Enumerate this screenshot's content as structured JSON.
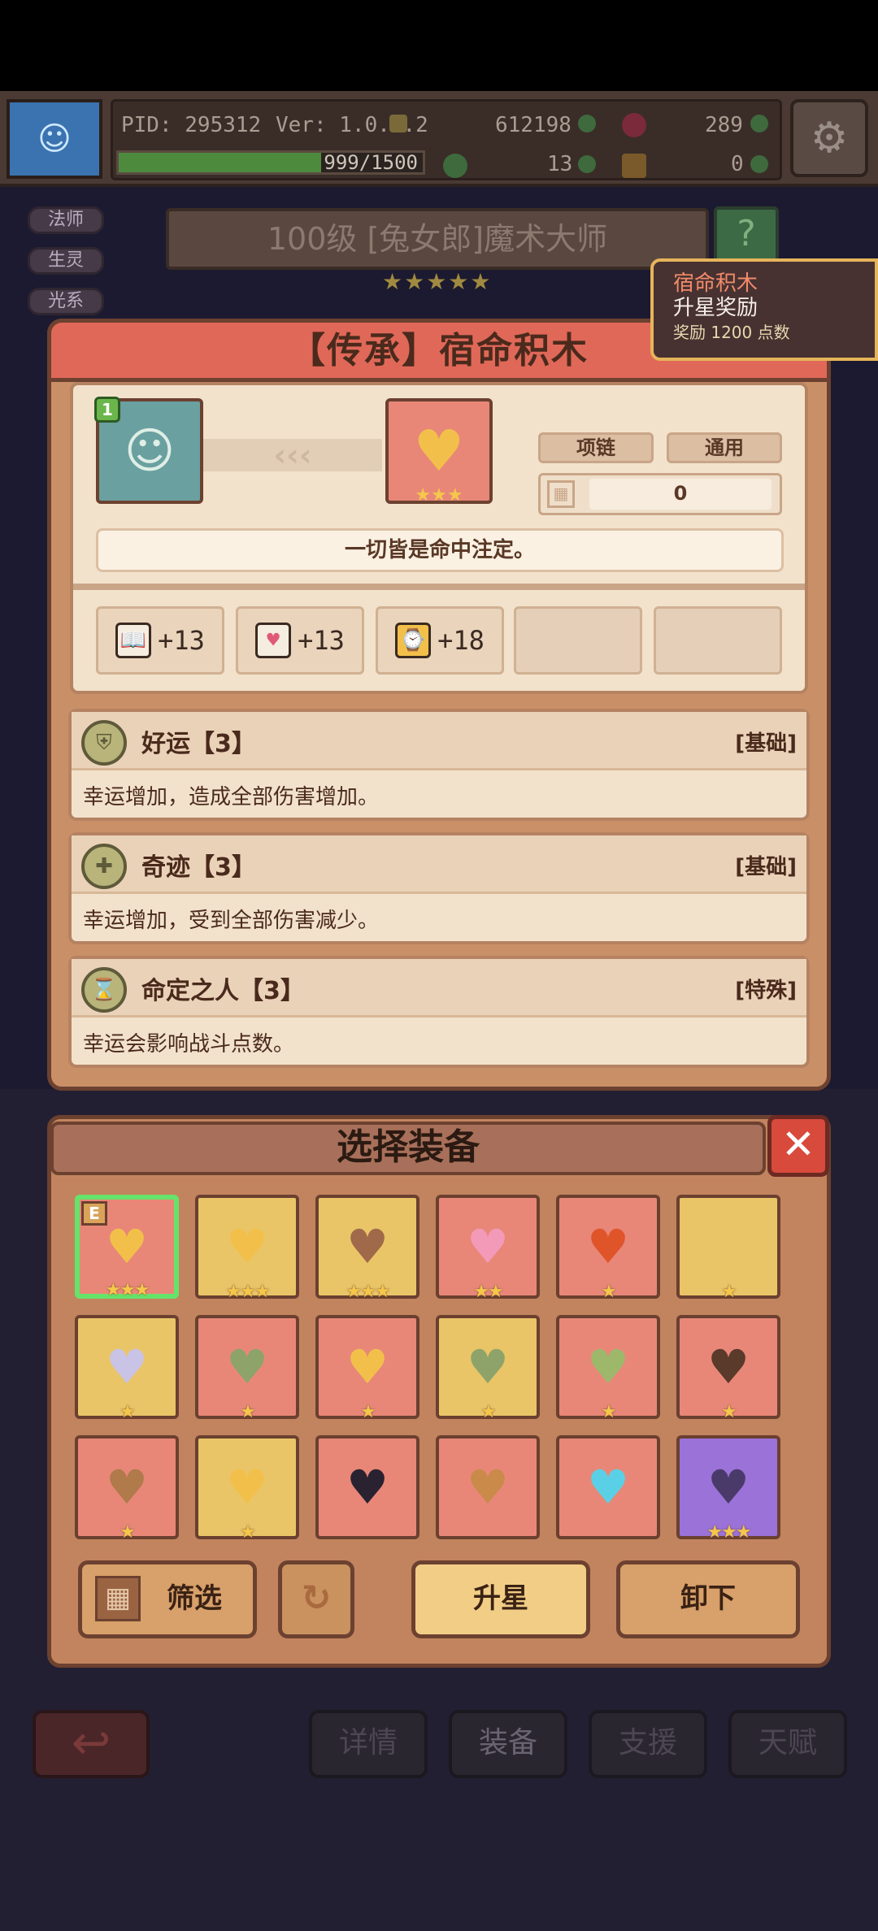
{
  "hud": {
    "pid": "PID: 295312",
    "version": "Ver: 1.0.1.2",
    "coins": "612198",
    "gems": "289",
    "stamina": "999/1500",
    "stamina_fraction": 0.666,
    "clover": "13",
    "tool": "0"
  },
  "side_tags": [
    "法师",
    "生灵",
    "光系"
  ],
  "hero_title": "100级 [兔女郎]魔术大师",
  "reward_popup": {
    "title": "宿命积木",
    "subtitle": "升星奖励",
    "desc": "奖励 1200 点数"
  },
  "item_panel": {
    "title": "【传承】宿命积木",
    "hero_level": "1",
    "type_label": "项链",
    "usage_label": "通用",
    "count": "0",
    "quote": "一切皆是命中注定。",
    "stats": [
      {
        "icon": "book-icon",
        "value": "+13"
      },
      {
        "icon": "heart-icon",
        "value": "+13"
      },
      {
        "icon": "clock-icon",
        "value": "+18"
      }
    ],
    "skills": [
      {
        "name": "好运【3】",
        "type": "[基础]",
        "desc": "幸运增加，造成全部伤害增加。"
      },
      {
        "name": "奇迹【3】",
        "type": "[基础]",
        "desc": "幸运增加，受到全部伤害减少。"
      },
      {
        "name": "命定之人【3】",
        "type": "[特殊]",
        "desc": "幸运会影响战斗点数。"
      }
    ]
  },
  "equip_panel": {
    "title": "选择装备",
    "filter_label": "筛选",
    "star_up_label": "升星",
    "unequip_label": "卸下",
    "equipped_badge": "E"
  },
  "equip_slots": [
    {
      "bg": "#e88778",
      "stars": 3,
      "color": "#f2c04a",
      "selected": true
    },
    {
      "bg": "#e9c568",
      "stars": 3,
      "color": "#f2c04a"
    },
    {
      "bg": "#e9c568",
      "stars": 3,
      "color": "#a06a4a"
    },
    {
      "bg": "#e88778",
      "stars": 2,
      "color": "#f39ab8"
    },
    {
      "bg": "#e88778",
      "stars": 1,
      "color": "#e0542a"
    },
    {
      "bg": "#e9c568",
      "stars": 1,
      "color": "#e9c568"
    },
    {
      "bg": "#e9c568",
      "stars": 1,
      "color": "#c9c3e6"
    },
    {
      "bg": "#e88778",
      "stars": 1,
      "color": "#8ea36a"
    },
    {
      "bg": "#e88778",
      "stars": 1,
      "color": "#f2c04a"
    },
    {
      "bg": "#e9c568",
      "stars": 1,
      "color": "#8ea36a"
    },
    {
      "bg": "#e88778",
      "stars": 1,
      "color": "#9db86a"
    },
    {
      "bg": "#e88778",
      "stars": 1,
      "color": "#5a3a2a"
    },
    {
      "bg": "#e88778",
      "stars": 1,
      "color": "#b07a4a"
    },
    {
      "bg": "#e9c568",
      "stars": 1,
      "color": "#f2c04a"
    },
    {
      "bg": "#e88778",
      "stars": 0,
      "color": "#2a2230"
    },
    {
      "bg": "#e88778",
      "stars": 0,
      "color": "#c98a4a"
    },
    {
      "bg": "#e88778",
      "stars": 0,
      "color": "#5ad0e6"
    },
    {
      "bg": "#9a72d8",
      "stars": 3,
      "color": "#4a3a6a"
    }
  ],
  "bottom_nav": [
    "详情",
    "装备",
    "支援",
    "天赋"
  ]
}
